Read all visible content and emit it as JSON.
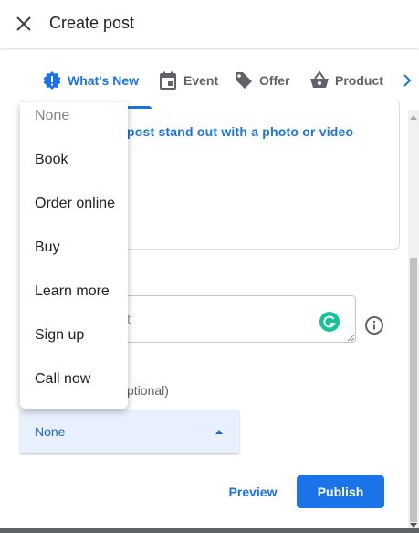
{
  "header": {
    "title": "Create post",
    "close_icon": "close-icon"
  },
  "tabs": [
    {
      "label": "What's New",
      "icon": "whats-new-icon",
      "active": true
    },
    {
      "label": "Event",
      "icon": "calendar-icon",
      "active": false
    },
    {
      "label": "Offer",
      "icon": "tag-icon",
      "active": false
    },
    {
      "label": "Product",
      "icon": "shopping-basket-icon",
      "active": false
    }
  ],
  "media": {
    "text": "post stand out with a photo or video"
  },
  "text_field": {
    "placeholder": "t"
  },
  "button_section": {
    "label": "ptional)"
  },
  "select": {
    "value": "None"
  },
  "menu": {
    "items": [
      "None",
      "Book",
      "Order online",
      "Buy",
      "Learn more",
      "Sign up",
      "Call now"
    ]
  },
  "actions": {
    "preview_label": "Preview",
    "publish_label": "Publish"
  },
  "colors": {
    "accent": "#1a73e8",
    "select_bg": "#e8f0fe",
    "grammarly": "#15c39a"
  }
}
